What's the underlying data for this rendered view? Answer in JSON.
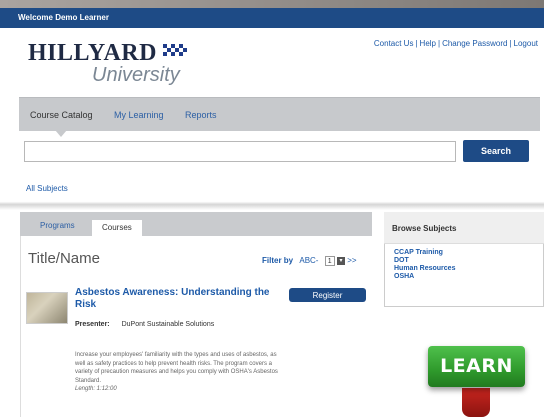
{
  "topbar": {
    "welcome": "Welcome Demo Learner"
  },
  "logo": {
    "brand": "HILLYARD",
    "subtitle": "University"
  },
  "util_links": [
    "Contact Us",
    "Help",
    "Change Password",
    "Logout"
  ],
  "nav": {
    "tabs": [
      {
        "label": "Course Catalog",
        "active": true
      },
      {
        "label": "My Learning",
        "active": false
      },
      {
        "label": "Reports",
        "active": false
      }
    ]
  },
  "search": {
    "value": "",
    "placeholder": "",
    "button_label": "Search"
  },
  "all_subjects": "All Subjects",
  "panel": {
    "tabs": [
      {
        "label": "Programs",
        "active": false
      },
      {
        "label": "Courses",
        "active": true
      }
    ],
    "heading": "Title/Name",
    "filter_label": "Filter by",
    "filter_abc": "ABC-",
    "filter_page": "1",
    "filter_next": ">>"
  },
  "course": {
    "title": "Asbestos Awareness: Understanding the Risk",
    "register_label": "Register",
    "presenter_label": "Presenter:",
    "presenter_name": "DuPont Sustainable Solutions",
    "description": "Increase your employees' familiarity with the types and uses of asbestos, as well as safety practices to help prevent health risks. The program covers a variety of precaution measures and helps you comply with OSHA's Asbestos Standard.",
    "length": "Length: 1:12:00"
  },
  "browse": {
    "heading": "Browse Subjects",
    "items": [
      "CCAP Training",
      "DOT",
      "Human Resources",
      "OSHA"
    ]
  },
  "learn_key": {
    "label": "LEARN"
  },
  "colors": {
    "brand_blue": "#1e4b86",
    "link_blue": "#1d5aa8",
    "nav_gray": "#c7c9cc",
    "learn_green": "#2f9a2c"
  }
}
